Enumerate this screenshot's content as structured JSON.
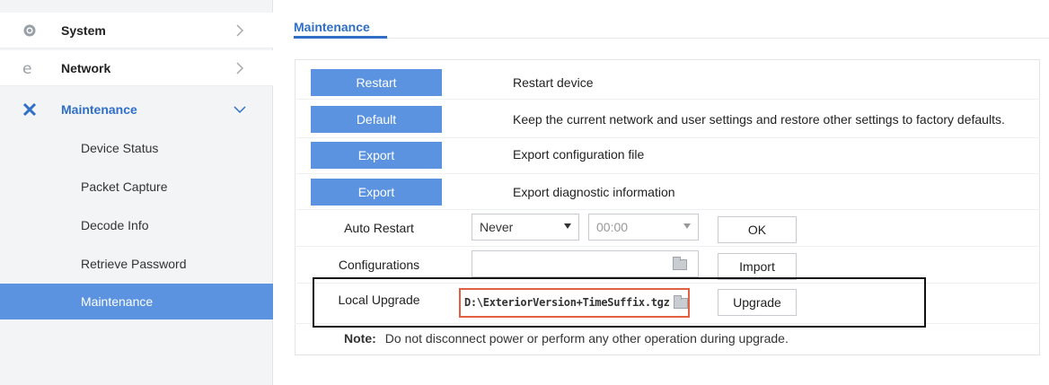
{
  "sidebar": {
    "items": [
      {
        "label": "System",
        "icon": "gear-icon"
      },
      {
        "label": "Network",
        "icon": "network-icon"
      },
      {
        "label": "Maintenance",
        "icon": "tools-icon"
      }
    ],
    "subitems": [
      {
        "label": "Device Status"
      },
      {
        "label": "Packet Capture"
      },
      {
        "label": "Decode Info"
      },
      {
        "label": "Retrieve Password"
      },
      {
        "label": "Maintenance"
      }
    ],
    "accent_color": "#5b93e0"
  },
  "main": {
    "tab": "Maintenance",
    "actions": [
      {
        "button": "Restart",
        "description": "Restart device"
      },
      {
        "button": "Default",
        "description": "Keep the current network and user settings and restore other settings to factory defaults."
      },
      {
        "button": "Export",
        "description": "Export configuration file"
      },
      {
        "button": "Export",
        "description": "Export diagnostic information"
      }
    ],
    "auto_restart": {
      "label": "Auto Restart",
      "frequency": "Never",
      "time": "00:00",
      "ok_label": "OK"
    },
    "configurations": {
      "label": "Configurations",
      "value": "",
      "import_label": "Import"
    },
    "local_upgrade": {
      "label": "Local Upgrade",
      "value": "D:\\ExteriorVersion+TimeSuffix.tgz",
      "upgrade_label": "Upgrade"
    },
    "note": {
      "label": "Note:",
      "text": "Do not disconnect power or perform any other operation during upgrade."
    }
  }
}
